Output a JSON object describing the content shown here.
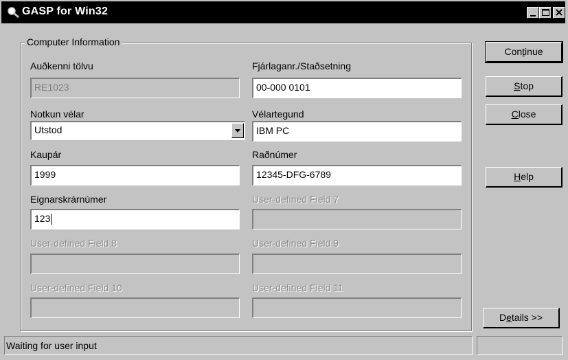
{
  "window": {
    "title": "GASP for Win32"
  },
  "group": {
    "legend": "Computer Information"
  },
  "fields": {
    "f1": {
      "label": "Auðkenni tölvu",
      "value": "RE1023"
    },
    "f2": {
      "label": "Fjárlaganr./Staðsetning",
      "value": "00-000 0101"
    },
    "f3": {
      "label": "Notkun vélar",
      "value": "Utstod"
    },
    "f4": {
      "label": "Vélartegund",
      "value": "IBM PC"
    },
    "f5": {
      "label": "Kaupár",
      "value": "1999"
    },
    "f6": {
      "label": "Raðnúmer",
      "value": "12345-DFG-6789"
    },
    "f7": {
      "label": "Eignarskrárnúmer",
      "value": "123"
    },
    "f8": {
      "label": "User-defined Field 7",
      "value": ""
    },
    "f9": {
      "label": "User-defined Field 8",
      "value": ""
    },
    "f10": {
      "label": "User-defined Field 9",
      "value": ""
    },
    "f11": {
      "label": "User-defined Field 10",
      "value": ""
    },
    "f12": {
      "label": "User-defined Field 11",
      "value": ""
    }
  },
  "buttons": {
    "continue": {
      "pre": "Con",
      "u": "t",
      "post": "inue"
    },
    "stop": {
      "pre": "",
      "u": "S",
      "post": "top"
    },
    "close": {
      "pre": "",
      "u": "C",
      "post": "lose"
    },
    "help": {
      "pre": "",
      "u": "H",
      "post": "elp"
    },
    "details": {
      "pre": "D",
      "u": "e",
      "post": "tails >>"
    }
  },
  "status": {
    "text": "Waiting for user input",
    "panel2": ""
  },
  "icons": {
    "title": "magnifier-icon",
    "minimize": "minimize-icon",
    "maximize": "maximize-icon",
    "close": "close-icon",
    "dropdown": "chevron-down-icon"
  }
}
